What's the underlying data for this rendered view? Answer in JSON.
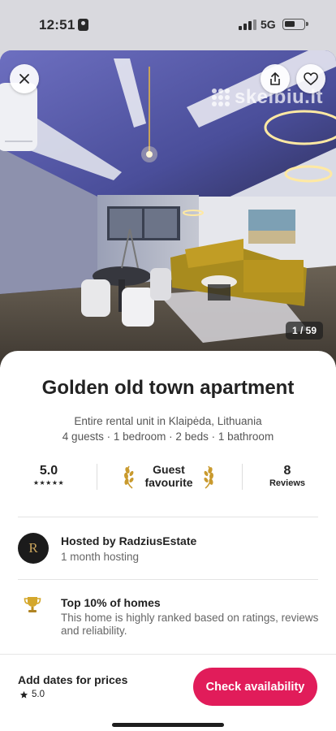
{
  "status_bar": {
    "time": "12:51",
    "network": "5G"
  },
  "photo": {
    "watermark": "skelbiu.lt",
    "counter": "1 / 59"
  },
  "listing": {
    "title": "Golden old town apartment",
    "subtitle": "Entire rental unit in Klaipėda, Lithuania",
    "details": "4 guests · 1 bedroom · 2 beds · 1 bathroom"
  },
  "stats": {
    "rating": "5.0",
    "stars": "★★★★★",
    "guest_favourite_line1": "Guest",
    "guest_favourite_line2": "favourite",
    "reviews_count": "8",
    "reviews_label": "Reviews"
  },
  "host": {
    "avatar_letter": "R",
    "name": "Hosted by RadziusEstate",
    "duration": "1 month hosting"
  },
  "highlight": {
    "title": "Top 10% of homes",
    "description": "This home is highly ranked based on ratings, reviews and reliability."
  },
  "footer": {
    "price_label": "Add dates for prices",
    "rating": "5.0",
    "cta": "Check availability"
  },
  "colors": {
    "accent": "#e11c5a",
    "laurel_gold": "#c99a2e"
  },
  "icons": [
    "focus-icon",
    "signal-icon",
    "battery-icon",
    "close-icon",
    "share-icon",
    "heart-icon",
    "laurel-icon",
    "trophy-icon",
    "star-icon"
  ]
}
